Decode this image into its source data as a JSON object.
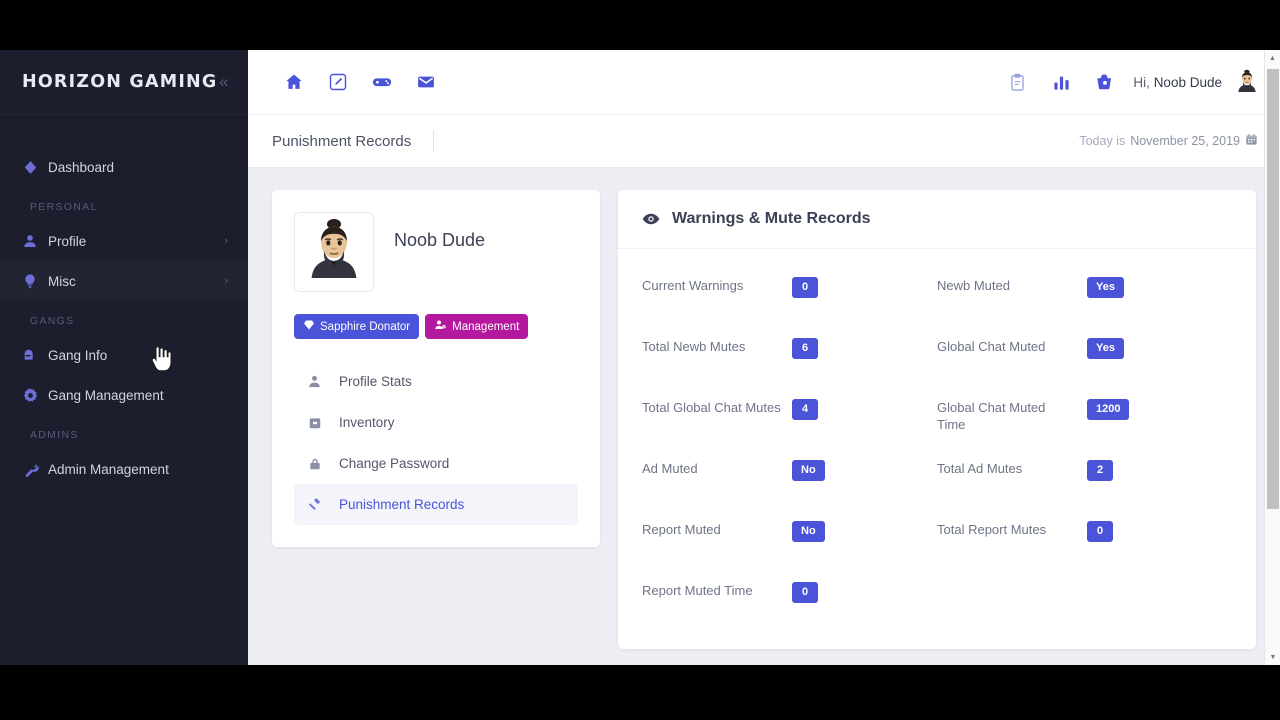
{
  "brand": {
    "title": "HORIZON GAMING",
    "collapse_icon": "chevron-double-left-icon"
  },
  "sidebar": {
    "groups": [
      {
        "label": "",
        "items": [
          {
            "label": "Dashboard",
            "icon": "diamond-icon",
            "chevron": ""
          }
        ]
      },
      {
        "label": "PERSONAL",
        "items": [
          {
            "label": "Profile",
            "icon": "user-icon",
            "chevron": "›"
          },
          {
            "label": "Misc",
            "icon": "lightbulb-icon",
            "chevron": "›"
          }
        ]
      },
      {
        "label": "GANGS",
        "items": [
          {
            "label": "Gang Info",
            "icon": "mailbox-icon",
            "chevron": ""
          },
          {
            "label": "Gang Management",
            "icon": "gear-icon",
            "chevron": ""
          }
        ]
      },
      {
        "label": "ADMINS",
        "items": [
          {
            "label": "Admin Management",
            "icon": "wrench-icon",
            "chevron": ""
          }
        ]
      }
    ]
  },
  "topbar": {
    "left_icons": [
      "home-icon",
      "edit-square-icon",
      "gamepad-icon",
      "envelope-icon"
    ],
    "right_icons": [
      "clipboard-icon",
      "bar-chart-icon",
      "basket-icon"
    ],
    "greeting_prefix": "Hi,",
    "user_name": "Noob Dude",
    "avatar": "user-avatar"
  },
  "pagebar": {
    "title": "Punishment Records",
    "today_prefix": "Today is",
    "today_date": "November 25, 2019",
    "calendar_icon": "calendar-icon"
  },
  "profile": {
    "name": "Noob Dude",
    "avatar": "user-avatar-large",
    "badges": [
      {
        "label": "Sapphire Donator",
        "icon": "gem-icon",
        "color": "#4b53d8"
      },
      {
        "label": "Management",
        "icon": "user-cog-icon",
        "color": "#b4189e"
      }
    ],
    "menu": [
      {
        "label": "Profile Stats",
        "icon": "user-icon",
        "active": false
      },
      {
        "label": "Inventory",
        "icon": "box-icon",
        "active": false
      },
      {
        "label": "Change Password",
        "icon": "lock-icon",
        "active": false
      },
      {
        "label": "Punishment Records",
        "icon": "gavel-icon",
        "active": true
      }
    ]
  },
  "records": {
    "title": "Warnings & Mute Records",
    "title_icon": "eye-icon",
    "left_column": [
      {
        "label": "Current Warnings",
        "value": "0"
      },
      {
        "label": "Total Newb Mutes",
        "value": "6"
      },
      {
        "label": "Total Global Chat Mutes",
        "value": "4"
      },
      {
        "label": "Ad Muted",
        "value": "No"
      },
      {
        "label": "Report Muted",
        "value": "No"
      },
      {
        "label": "Report Muted Time",
        "value": "0"
      }
    ],
    "right_column": [
      {
        "label": "Newb Muted",
        "value": "Yes"
      },
      {
        "label": "Global Chat Muted",
        "value": "Yes"
      },
      {
        "label": "Global Chat Muted Time",
        "value": "1200"
      },
      {
        "label": "Total Ad Mutes",
        "value": "2"
      },
      {
        "label": "Total Report Mutes",
        "value": "0"
      },
      {
        "label": "",
        "value": ""
      }
    ]
  },
  "colors": {
    "accent": "#4b53d8",
    "sidebar_bg": "#1c1e2d",
    "page_bg": "#eceef3",
    "badge_management": "#b4189e"
  }
}
